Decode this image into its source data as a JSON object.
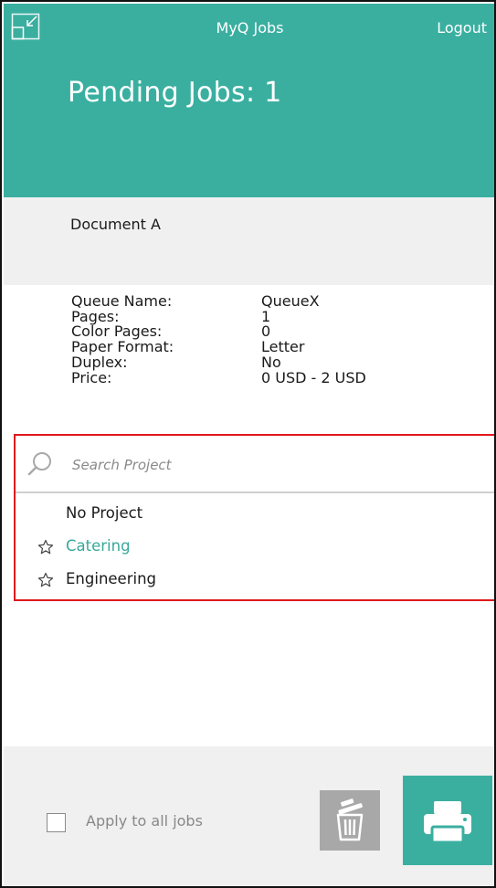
{
  "header": {
    "app_title": "MyQ Jobs",
    "logout_label": "Logout",
    "pending_title": "Pending Jobs: 1",
    "collapse_icon": "collapse-icon",
    "background_color": "#3aafa0"
  },
  "document": {
    "name": "Document A"
  },
  "details": [
    {
      "key": "Queue Name:",
      "value": "QueueX"
    },
    {
      "key": "Pages:",
      "value": "1"
    },
    {
      "key": "Color Pages:",
      "value": "0"
    },
    {
      "key": "Paper Format:",
      "value": "Letter"
    },
    {
      "key": "Duplex:",
      "value": "No"
    },
    {
      "key": "Price:",
      "value": "0 USD - 2 USD"
    }
  ],
  "project_search": {
    "placeholder": "Search Project",
    "value": "",
    "icon": "search-icon",
    "highlight_color": "#e0181b"
  },
  "projects": [
    {
      "label": "No Project",
      "starred_icon": false,
      "selected": false
    },
    {
      "label": "Catering",
      "starred_icon": true,
      "selected": true
    },
    {
      "label": "Engineering",
      "starred_icon": true,
      "selected": false
    }
  ],
  "footer": {
    "apply_all_label": "Apply to all jobs",
    "apply_all_checked": false,
    "delete_icon": "trash-icon",
    "print_icon": "printer-icon",
    "accent_color": "#3aafa0"
  }
}
